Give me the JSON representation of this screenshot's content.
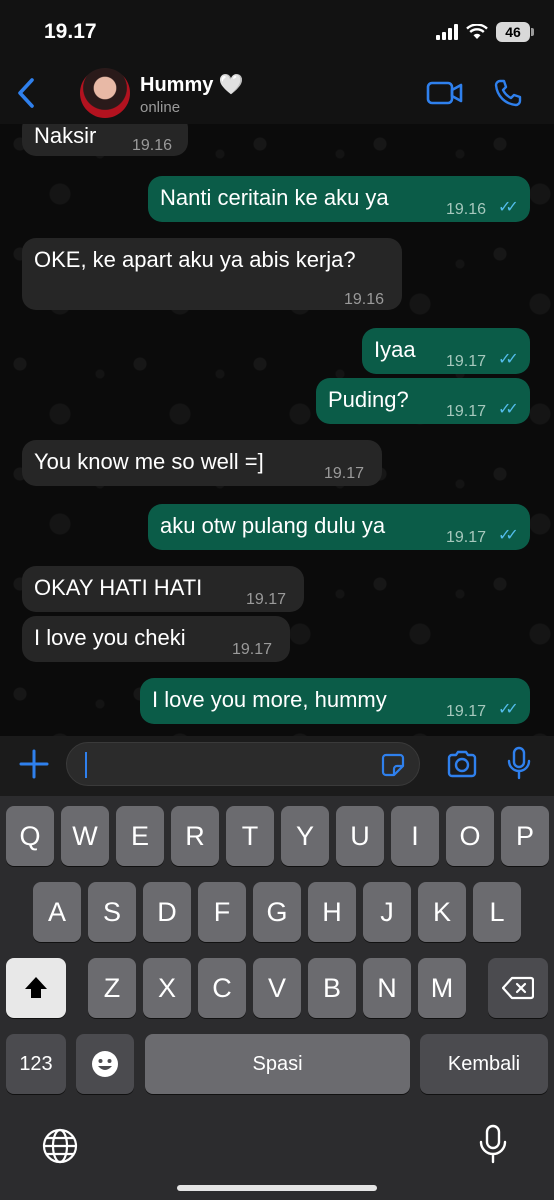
{
  "status_bar": {
    "time": "19.17",
    "battery": "46"
  },
  "header": {
    "name": "Hummy 🤍",
    "status": "online"
  },
  "messages": [
    {
      "dir": "in",
      "text": "Naksir",
      "time": "19.16"
    },
    {
      "dir": "out",
      "text": "Nanti ceritain ke aku ya",
      "time": "19.16",
      "read": true
    },
    {
      "dir": "in",
      "text": "OKE, ke apart aku ya abis kerja?",
      "time": "19.16"
    },
    {
      "dir": "out",
      "text": "Iyaa",
      "time": "19.17",
      "read": true
    },
    {
      "dir": "out",
      "text": "Puding?",
      "time": "19.17",
      "read": true
    },
    {
      "dir": "in",
      "text": "You know me so well =]",
      "time": "19.17"
    },
    {
      "dir": "out",
      "text": "aku otw pulang dulu ya",
      "time": "19.17",
      "read": true
    },
    {
      "dir": "in",
      "text": "OKAY HATI HATI",
      "time": "19.17"
    },
    {
      "dir": "in",
      "text": "I love you cheki",
      "time": "19.17"
    },
    {
      "dir": "out",
      "text": "I love you more, hummy",
      "time": "19.17",
      "read": true
    }
  ],
  "composer": {
    "value": ""
  },
  "keyboard": {
    "row1": [
      "Q",
      "W",
      "E",
      "R",
      "T",
      "Y",
      "U",
      "I",
      "O",
      "P"
    ],
    "row2": [
      "A",
      "S",
      "D",
      "F",
      "G",
      "H",
      "J",
      "K",
      "L"
    ],
    "row3": [
      "Z",
      "X",
      "C",
      "V",
      "B",
      "N",
      "M"
    ],
    "numbers_label": "123",
    "space_label": "Spasi",
    "return_label": "Kembali"
  },
  "colors": {
    "accent": "#2f80ed",
    "outgoing_bubble": "#0b5c48",
    "incoming_bubble": "#262626",
    "read_ticks": "#53bdeb"
  },
  "icons": [
    "back-icon",
    "video-call-icon",
    "phone-icon",
    "plus-icon",
    "sticker-icon",
    "camera-icon",
    "microphone-icon",
    "shift-icon",
    "backspace-icon",
    "emoji-icon",
    "globe-icon",
    "dictation-icon"
  ]
}
